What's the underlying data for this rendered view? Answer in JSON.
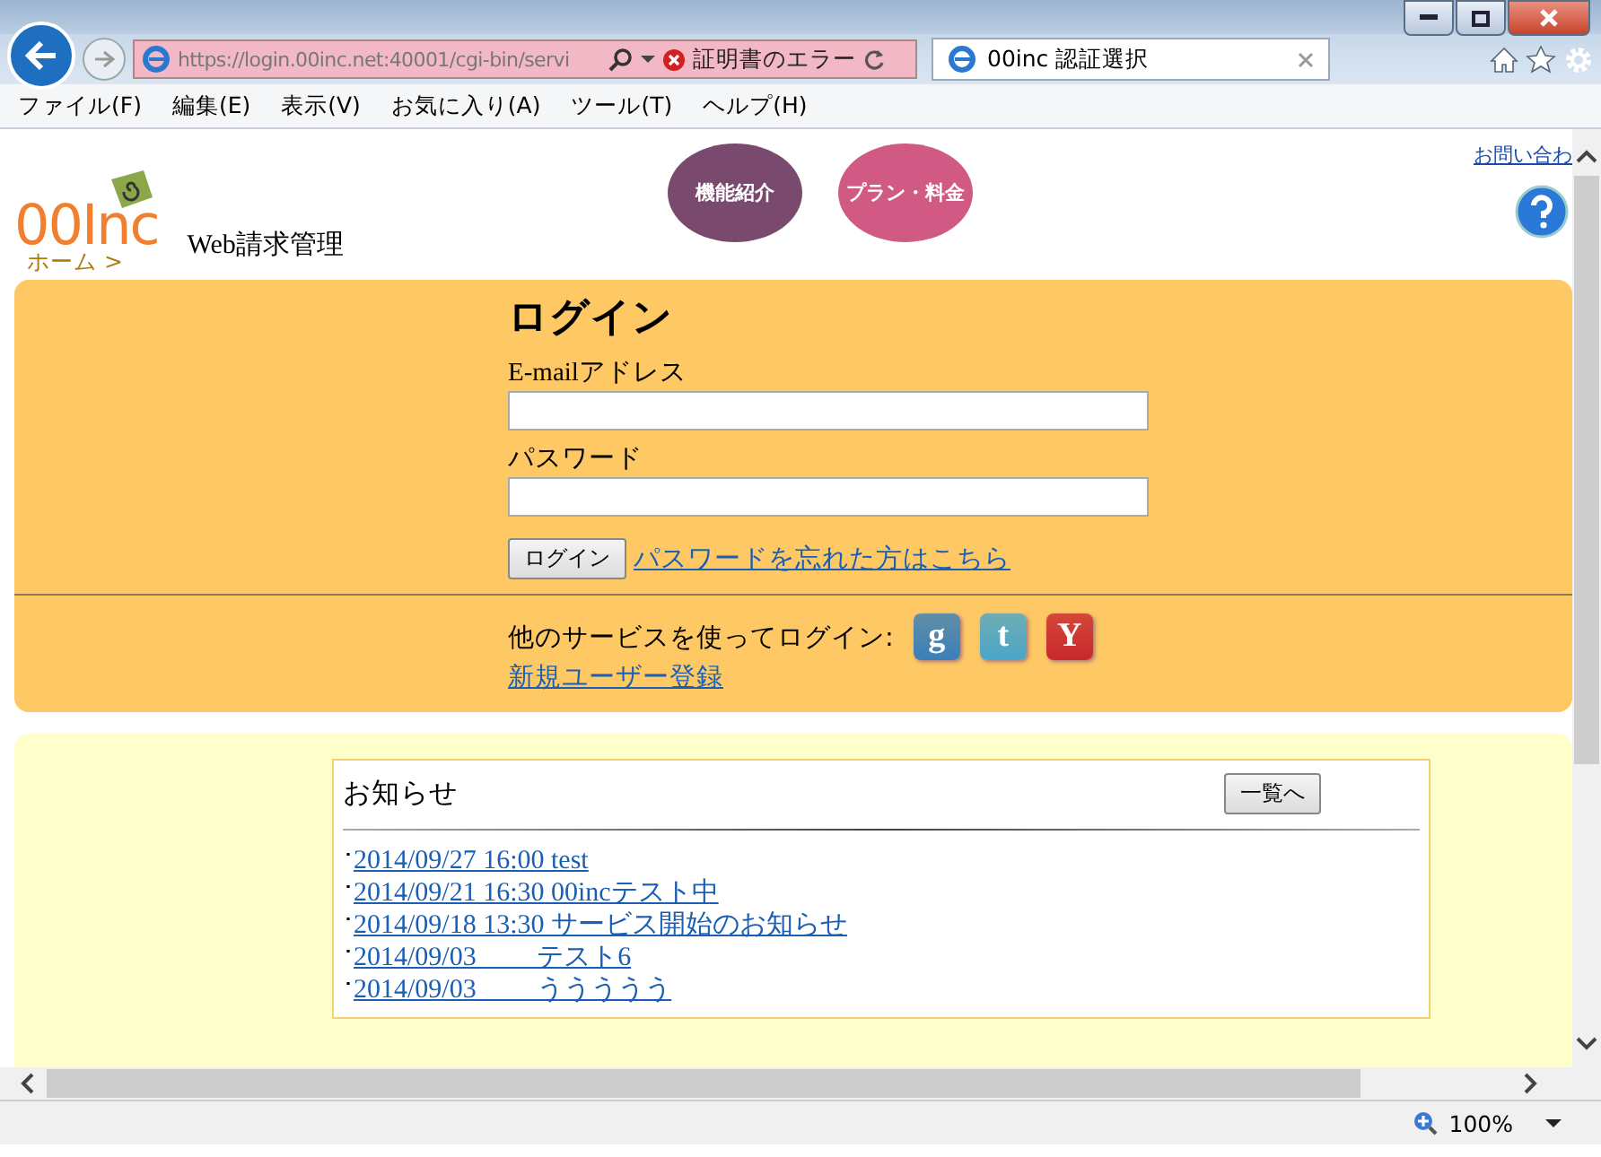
{
  "browser": {
    "address": "https://login.00inc.net:40001/cgi-bin/servi",
    "cert_error": "証明書のエラー",
    "tabs": [
      {
        "label": "00inc 認証選択",
        "selected": true
      }
    ],
    "menu": [
      "ファイル(F)",
      "編集(E)",
      "表示(V)",
      "お気に入り(A)",
      "ツール(T)",
      "ヘルプ(H)"
    ],
    "zoom": "100%"
  },
  "header": {
    "logo": "00Inc",
    "site_title": "Web請求管理",
    "nav": [
      {
        "label": "機能紹介",
        "color": "#7a4a6e"
      },
      {
        "label": "プラン・料金",
        "color": "#d05a84"
      }
    ],
    "contact_link": "お問い合わ",
    "breadcrumb": "ホーム >"
  },
  "login": {
    "title": "ログイン",
    "email_label": "E-mailアドレス",
    "password_label": "パスワード",
    "submit": "ログイン",
    "forgot_link": "パスワードを忘れた方はこちら",
    "social_label": "他のサービスを使ってログイン:",
    "social": [
      {
        "kind": "google",
        "letter": "g"
      },
      {
        "kind": "twitter",
        "letter": "t"
      },
      {
        "kind": "yahoo",
        "letter": "Y"
      }
    ],
    "register_link": "新規ユーザー登録"
  },
  "news": {
    "title": "お知らせ",
    "list_button": "一覧へ",
    "items": [
      {
        "bullet": "･",
        "text": "2014/09/27 16:00 test"
      },
      {
        "bullet": "･",
        "text": "2014/09/21 16:30 00incテスト中"
      },
      {
        "bullet": "･",
        "text": "2014/09/18 13:30 サービス開始のお知らせ"
      },
      {
        "bullet": "･",
        "text": "2014/09/03　　 テスト6"
      },
      {
        "bullet": "･",
        "text": "2014/09/03　　 ううううう"
      }
    ]
  }
}
